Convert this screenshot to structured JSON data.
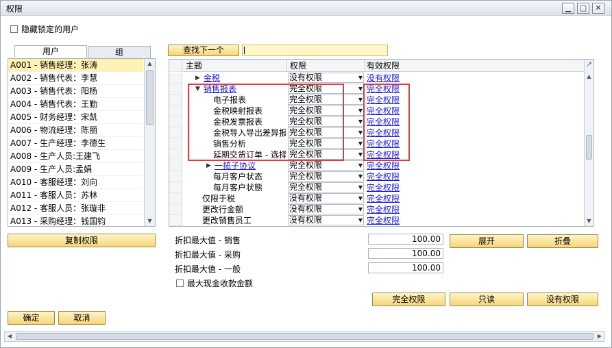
{
  "window": {
    "title": "权限",
    "min": "▁",
    "max": "□",
    "close": "✕"
  },
  "hide_locked_label": "隐藏锁定的用户",
  "tabs": [
    {
      "label": "用户"
    },
    {
      "label": "组"
    }
  ],
  "users": [
    "A001 - 销售经理：张涛",
    "A002 - 销售代表：李慧",
    "A003 - 销售代表：阳杨",
    "A004 - 销售代表：王勤",
    "A005 - 财务经理：宋凯",
    "A006 - 物流经理：陈丽",
    "A007 - 生产经理：李德生",
    "A008 - 生产人员:王建飞",
    "A009 - 生产人员:孟娟",
    "A010 - 客服经理：刘向",
    "A011 - 客服人员：苏林",
    "A012 - 客服人员：张璇非",
    "A013 - 采购经理：钱国钧"
  ],
  "copy_permissions_label": "复制权限",
  "find_next_label": "查找下一个",
  "search_value": "",
  "grid": {
    "headers": {
      "subject": "主题",
      "permission": "权限",
      "effective": "有效权限"
    },
    "rows": [
      {
        "subject": "金税",
        "permission": "没有权限",
        "effective": "没有权限",
        "level": 1,
        "expander": "▶",
        "link": true
      },
      {
        "subject": "销售报表",
        "permission": "完全权限",
        "effective": "完全权限",
        "level": 1,
        "expander": "▼",
        "link": true
      },
      {
        "subject": "电子报表",
        "permission": "完全权限",
        "effective": "完全权限",
        "level": 2
      },
      {
        "subject": "金税映射报表",
        "permission": "完全权限",
        "effective": "完全权限",
        "level": 2
      },
      {
        "subject": "金税发票报表",
        "permission": "完全权限",
        "effective": "完全权限",
        "level": 2
      },
      {
        "subject": "金税导入导出差异报",
        "permission": "完全权限",
        "effective": "完全权限",
        "level": 2
      },
      {
        "subject": "销售分析",
        "permission": "完全权限",
        "effective": "完全权限",
        "level": 2
      },
      {
        "subject": "延期交货订单 - 选择",
        "permission": "完全权限",
        "effective": "完全权限",
        "level": 2
      },
      {
        "subject": "一揽子协议",
        "permission": "完全权限",
        "effective": "完全权限",
        "level": 2,
        "expander": "▶",
        "link": true
      },
      {
        "subject": "每月客户状态",
        "permission": "完全权限",
        "effective": "完全权限",
        "level": 2
      },
      {
        "subject": "每月客户状態",
        "permission": "完全权限",
        "effective": "完全权限",
        "level": 2
      },
      {
        "subject": "仅限于税",
        "permission": "没有权限",
        "effective": "完全权限",
        "level": 0
      },
      {
        "subject": "更改行金额",
        "permission": "没有权限",
        "effective": "完全权限",
        "level": 0
      },
      {
        "subject": "更改销售员工",
        "permission": "没有权限",
        "effective": "完全权限",
        "level": 0
      }
    ]
  },
  "discounts": [
    {
      "label": "折扣最大值 - 销售",
      "value": "100.00"
    },
    {
      "label": "折扣最大值 - 采购",
      "value": "100.00"
    },
    {
      "label": "折扣最大值 - 一般",
      "value": "100.00"
    }
  ],
  "max_cash_label": "最大现金收款金额",
  "expand_label": "展开",
  "collapse_label": "折叠",
  "full_perm_label": "完全权限",
  "read_only_label": "只读",
  "no_perm_label": "没有权限",
  "ok_label": "确定",
  "cancel_label": "取消",
  "colors": {
    "selection": "#fff2b3",
    "highlight_box": "#e0393e",
    "link": "#1a1ae0",
    "button": "#f5d577"
  }
}
